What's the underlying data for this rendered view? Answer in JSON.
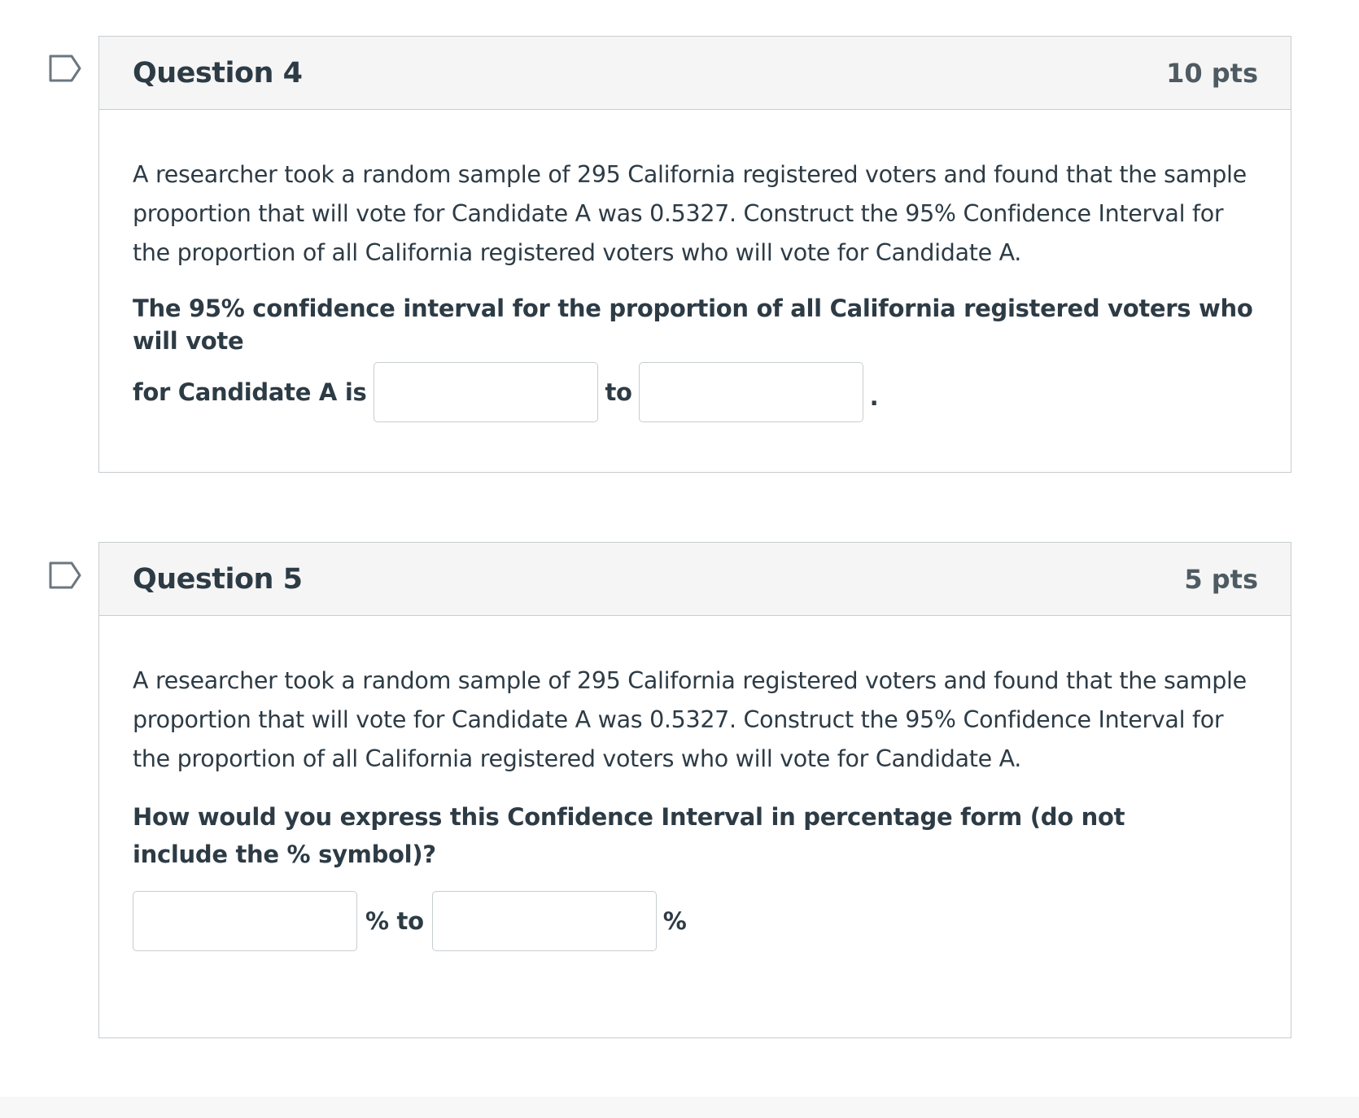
{
  "questions": [
    {
      "title": "Question 4",
      "points": "10 pts",
      "text": "A researcher took a random sample of 295 California registered voters and found that the sample proportion that will vote for Candidate A was 0.5327. Construct the 95% Confidence Interval for the proportion of all California registered voters who will vote for Candidate A.",
      "prompt_line1": "The 95% confidence interval for the proportion of all California registered voters who will vote",
      "prompt_line2_prefix": "for Candidate A is",
      "between_word": "to",
      "suffix": ".",
      "answer1_value": "",
      "answer2_value": ""
    },
    {
      "title": "Question 5",
      "points": "5 pts",
      "text": "A researcher took a random sample of 295 California registered voters and found that the sample proportion that will vote for Candidate A was 0.5327. Construct the 95% Confidence Interval for the proportion of all California registered voters who will vote for Candidate A.",
      "prompt": "How would you express this Confidence Interval in percentage form (do not include the % symbol)?",
      "between_word": "% to",
      "suffix": "%",
      "answer1_value": "",
      "answer2_value": ""
    }
  ],
  "colors": {
    "text": "#2d3b45",
    "border": "#c7cdd1",
    "header_bg": "#f5f5f5",
    "flag": "#6b7780"
  },
  "icons": {
    "flag": "flag-outline-icon"
  }
}
